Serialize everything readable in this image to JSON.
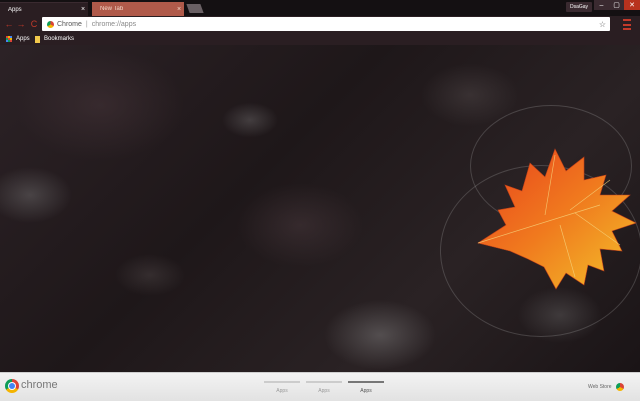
{
  "tabs": [
    {
      "label": "Apps",
      "active": true
    },
    {
      "label": "New Tab",
      "active": false
    }
  ],
  "profile": {
    "label": "DsaGay"
  },
  "window_controls": {
    "minimize": "–",
    "maximize": "▢",
    "close": "✕"
  },
  "omnibox": {
    "scheme": "Chrome",
    "url": "chrome://apps",
    "star": "☆"
  },
  "nav": {
    "back": "←",
    "forward": "→",
    "reload": "C"
  },
  "bookmarks": [
    {
      "label": "Apps",
      "icon": "apps-grid-icon"
    },
    {
      "label": "Bookmarks",
      "icon": "folder-icon"
    }
  ],
  "footer": {
    "brand": "chrome",
    "pages": [
      {
        "label": "Apps",
        "active": false
      },
      {
        "label": "Apps",
        "active": false
      },
      {
        "label": "Apps",
        "active": true
      }
    ],
    "webstore_label": "Web Store"
  },
  "colors": {
    "accent": "#c23a2a",
    "tab_inactive": "#b05a4a",
    "close": "#b8321e"
  }
}
